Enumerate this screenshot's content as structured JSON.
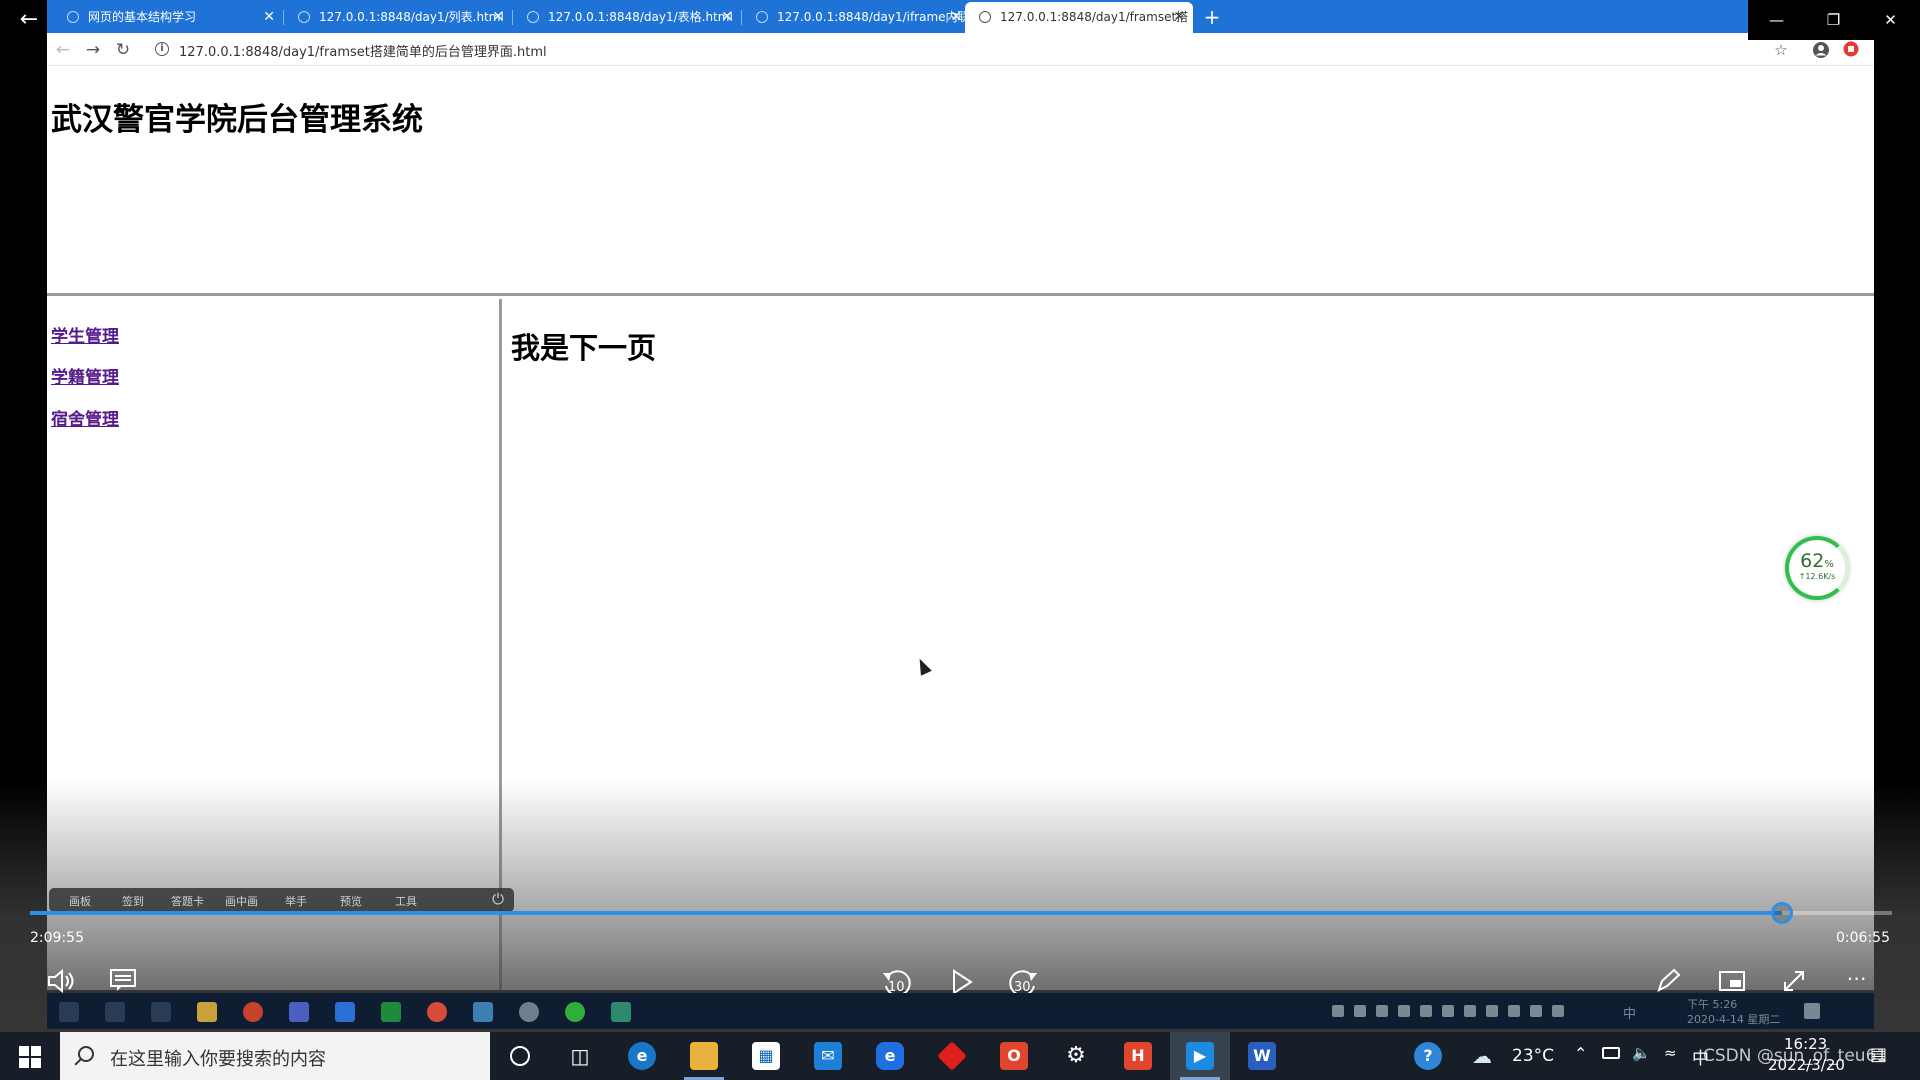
{
  "browser": {
    "tabs": [
      {
        "title": "网页的基本结构学习"
      },
      {
        "title": "127.0.0.1:8848/day1/列表.html"
      },
      {
        "title": "127.0.0.1:8848/day1/表格.html"
      },
      {
        "title": "127.0.0.1:8848/day1/iframe内联"
      },
      {
        "title": "127.0.0.1:8848/day1/framset搭"
      }
    ],
    "new_tab": "+",
    "close_glyph": "✕",
    "url": "127.0.0.1:8848/day1/framset搭建简单的后台管理界面.html",
    "window_controls": {
      "minimize": "—",
      "restore": "❐",
      "close": "✕"
    }
  },
  "page": {
    "header_title": "武汉警官学院后台管理系统",
    "menu": [
      {
        "label": "学生管理"
      },
      {
        "label": "学籍管理"
      },
      {
        "label": "宿舍管理"
      }
    ],
    "content_title": "我是下一页"
  },
  "speed_widget": {
    "percent": "62",
    "percent_unit": "%",
    "rate": "↑12.6K/s"
  },
  "class_toolbar": {
    "items": [
      "画板",
      "签到",
      "答题卡",
      "画中画",
      "举手",
      "预览",
      "工具"
    ]
  },
  "player": {
    "elapsed": "2:09:55",
    "remaining": "0:06:55",
    "progress": 0.941,
    "rewind_seconds": "10",
    "forward_seconds": "30",
    "accent": "#2d8fe8"
  },
  "video_taskbar": {
    "clock_time": "下午 5:26",
    "clock_date": "2020-4-14 星期二",
    "ime": "中"
  },
  "taskbar": {
    "search_placeholder": "在这里输入你要搜索的内容",
    "weather": "23°C",
    "ime": "中",
    "time": "16:23",
    "date": "2022/3/20",
    "watermark": "CSDN @sun_of_teu61"
  }
}
